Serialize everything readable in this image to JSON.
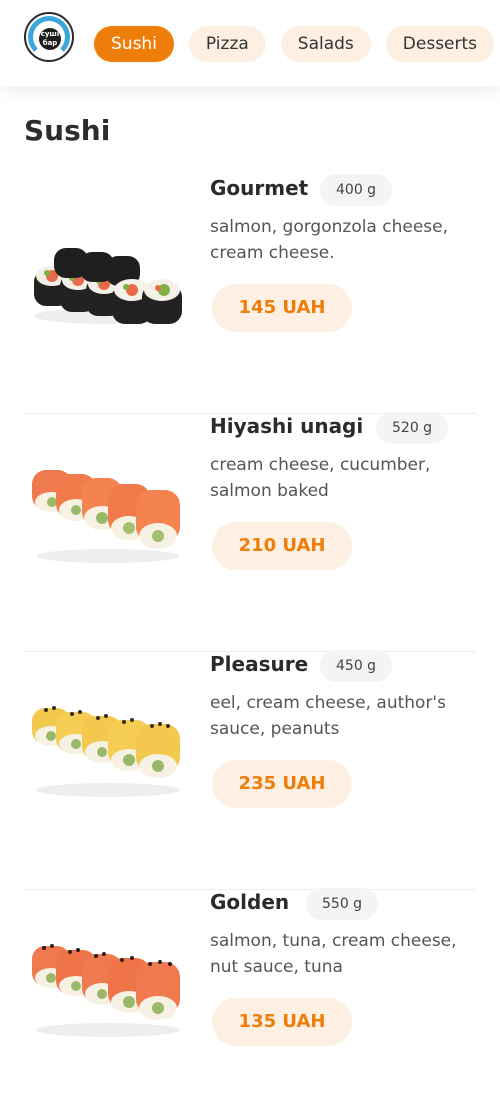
{
  "header": {
    "logo": {
      "line1": "суші",
      "line2": "бар"
    },
    "tabs": [
      {
        "label": "Sushi",
        "active": true
      },
      {
        "label": "Pizza",
        "active": false
      },
      {
        "label": "Salads",
        "active": false
      },
      {
        "label": "Desserts",
        "active": false
      }
    ]
  },
  "section": {
    "title": "Sushi"
  },
  "products": [
    {
      "name": "Gourmet",
      "weight": "400 g",
      "description": "salmon, gorgonzola cheese, cream cheese.",
      "price": "145 UAH",
      "image": "gourmet-roll-image"
    },
    {
      "name": "Hiyashi unagi",
      "weight": "520 g",
      "description": "cream cheese, cucumber, salmon baked",
      "price": "210 UAH",
      "image": "hiyashi-unagi-roll-image"
    },
    {
      "name": "Pleasure",
      "weight": "450 g",
      "description": "eel, cream cheese, author's sauce, peanuts",
      "price": "235 UAH",
      "image": "pleasure-roll-image"
    },
    {
      "name": "Golden",
      "weight": "550 g",
      "description": "salmon, tuna, cream cheese, nut sauce, tuna",
      "price": "135 UAH",
      "image": "golden-roll-image"
    }
  ],
  "colors": {
    "accent": "#ee7d0a",
    "pill_bg": "#fdf0e3",
    "weight_bg": "#f4f4f4",
    "text": "#2b2b2b"
  }
}
